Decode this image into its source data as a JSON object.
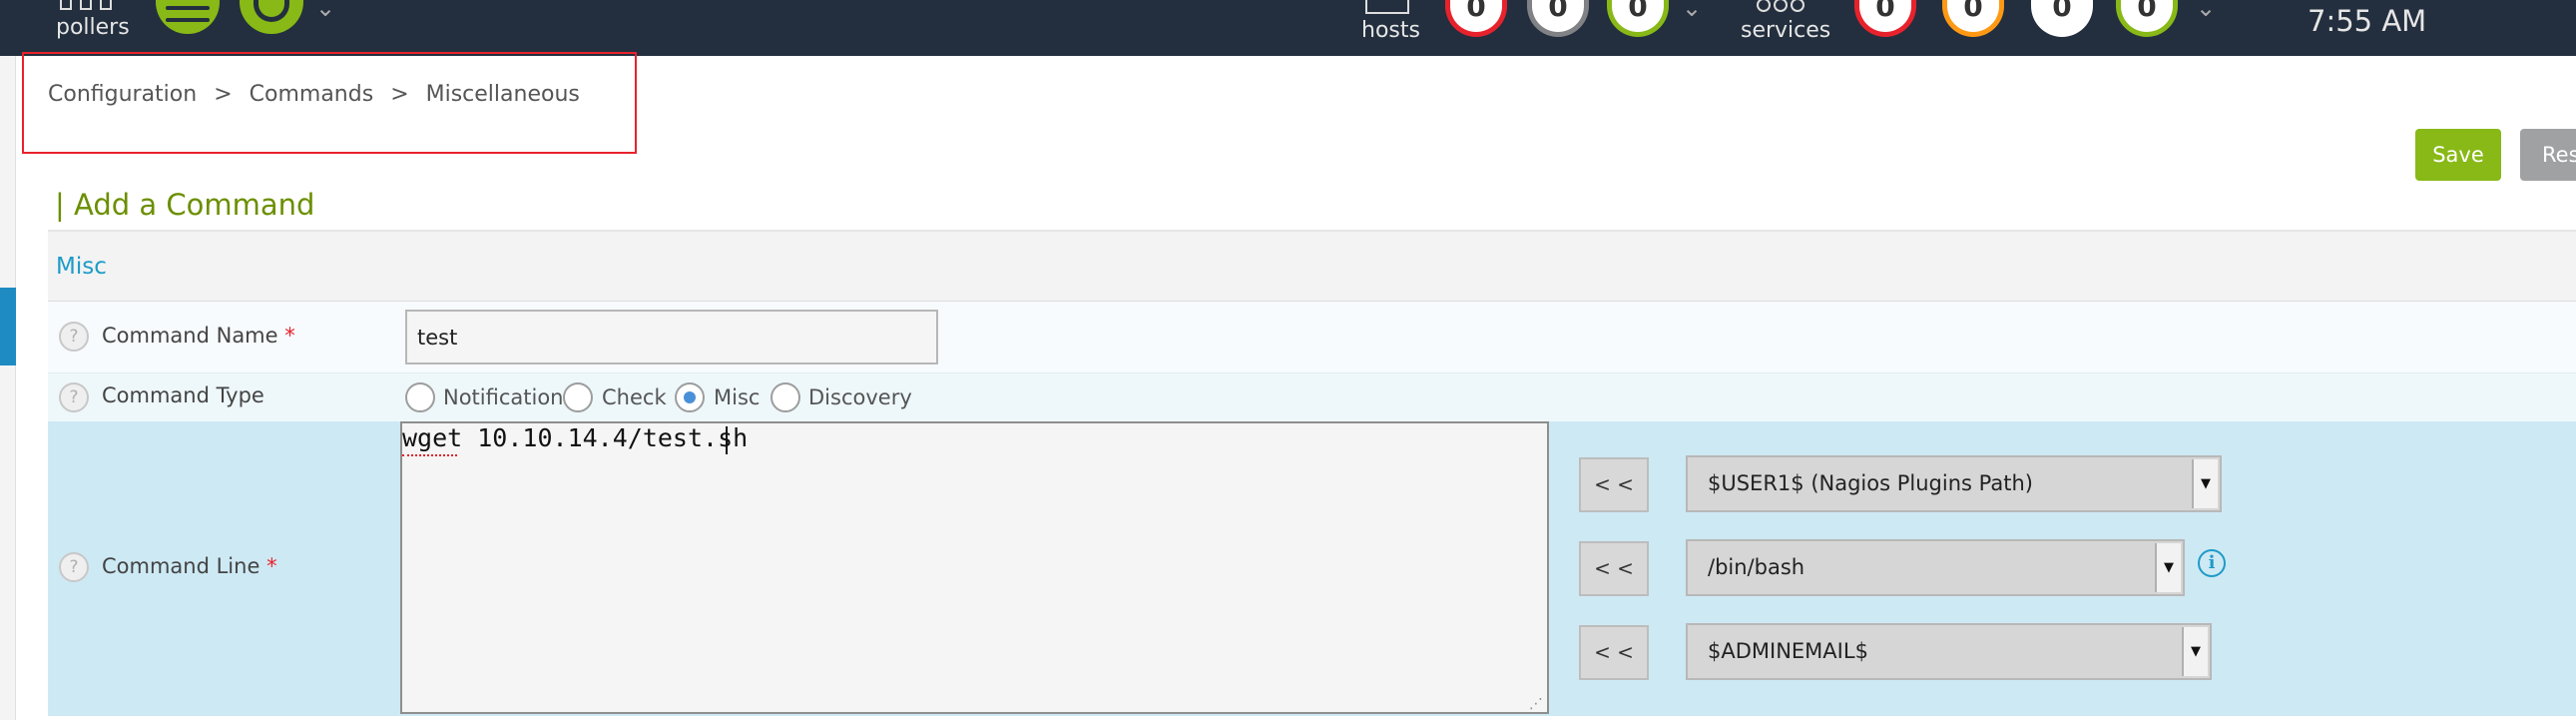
{
  "topbar": {
    "pollers_label": "pollers",
    "hosts_label": "hosts",
    "services_label": "services",
    "time": "7:55 AM",
    "host_counts": [
      "0",
      "0",
      "0"
    ],
    "service_counts": [
      "0",
      "0",
      "0",
      "0"
    ]
  },
  "breadcrumb": {
    "items": [
      "Configuration",
      "Commands",
      "Miscellaneous"
    ],
    "separator": ">"
  },
  "toolbar": {
    "save_label": "Save",
    "reset_label": "Res"
  },
  "page": {
    "title": "| Add a Command",
    "section": "Misc"
  },
  "form": {
    "command_name": {
      "label": "Command Name",
      "required_mark": "*",
      "value": "test"
    },
    "command_type": {
      "label": "Command Type",
      "options": [
        "Notification",
        "Check",
        "Misc",
        "Discovery"
      ],
      "selected": "Misc"
    },
    "command_line": {
      "label": "Command Line",
      "required_mark": "*",
      "value": "wget 10.10.14.4/test.sh"
    },
    "help_glyph": "?",
    "macro_buttons": [
      "< <",
      "< <",
      "< <"
    ],
    "macro_selects": [
      "$USER1$ (Nagios Plugins Path)",
      "/bin/bash",
      "$ADMINEMAIL$"
    ]
  },
  "colors": {
    "topbar_bg": "#232f3e",
    "accent_green": "#88b917",
    "accent_red": "#e8222c",
    "accent_orange": "#ff9913",
    "link_blue": "#1e9bc7"
  }
}
